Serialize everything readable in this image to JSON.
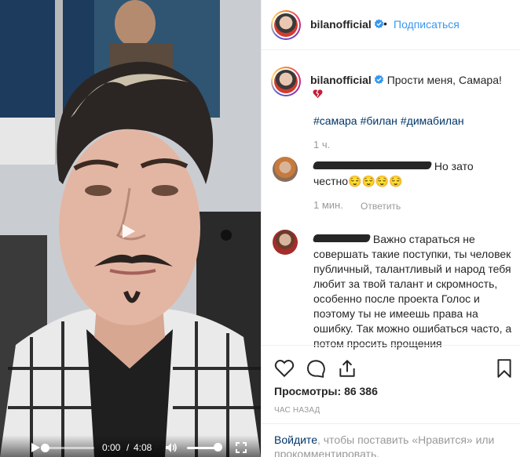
{
  "video": {
    "time_current": "0:00",
    "time_separator": "/",
    "time_duration": "4:08",
    "progress": 0.0,
    "volume": 0.8
  },
  "header": {
    "username": "bilanofficial",
    "separator": "•",
    "follow_label": "Подписаться"
  },
  "caption": {
    "username": "bilanofficial",
    "text": "Прости меня, Самара!",
    "emoji": "broken-heart-icon",
    "hashtags": [
      "#самара",
      "#билан",
      "#димабилан"
    ],
    "time": "1 ч."
  },
  "comments": [
    {
      "username_hidden": true,
      "text_before": "Но зато",
      "text_after": "честно😌😌😌😌",
      "time": "1 мин.",
      "reply_label": "Ответить"
    },
    {
      "username_hidden": true,
      "text": "Важно стараться не совершать такие поступки, ты человек публичный, талантливый и народ тебя любит за твой талант и скромность, особенно после проекта Голос и поэтому ты не имеешь права на ошибку. Так можно ошибаться часто, а потом просить прощения"
    }
  ],
  "actions": {
    "views_label": "Просмотры:",
    "views_count": "86 386",
    "time_ago": "ЧАС НАЗАД",
    "login_link": "Войдите",
    "login_text": ", чтобы поставить «Нравится» или прокомментировать."
  },
  "colors": {
    "link_blue": "#3897f0",
    "hashtag": "#003569",
    "muted": "#999999",
    "verified": "#3897f0"
  }
}
